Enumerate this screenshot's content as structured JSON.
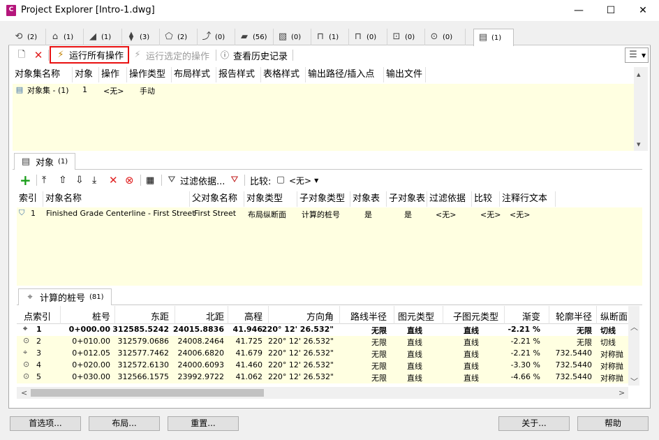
{
  "window": {
    "app_icon_text": "C",
    "title": "Project Explorer [Intro-1.dwg]",
    "minimize": "—",
    "maximize": "☐",
    "close": "✕"
  },
  "tabs": [
    {
      "icon": "alignment-icon",
      "glyph": "⟲",
      "count": "(2)"
    },
    {
      "icon": "profile-icon",
      "glyph": "⌂",
      "count": "(1)"
    },
    {
      "icon": "surface-icon",
      "glyph": "◢",
      "count": "(1)"
    },
    {
      "icon": "corridor-icon",
      "glyph": "⧫",
      "count": "(3)"
    },
    {
      "icon": "site-icon",
      "glyph": "⬠",
      "count": "(2)"
    },
    {
      "icon": "featureline-icon",
      "glyph": "⤴",
      "count": "(0)"
    },
    {
      "icon": "assembly-icon",
      "glyph": "▰",
      "count": "(56)"
    },
    {
      "icon": "parcel-icon",
      "glyph": "▧",
      "count": "(0)"
    },
    {
      "icon": "structure-icon",
      "glyph": "⊓",
      "count": "(1)"
    },
    {
      "icon": "pipe-icon",
      "glyph": "⊓",
      "count": "(0)"
    },
    {
      "icon": "section-icon",
      "glyph": "⊡",
      "count": "(0)"
    },
    {
      "icon": "view-icon",
      "glyph": "⊙",
      "count": "(0)"
    },
    {
      "icon": "objectset-icon",
      "glyph": "▤",
      "count": "(1)"
    }
  ],
  "toolbar1": {
    "new_label": "",
    "delete_label": "",
    "run_all": "运行所有操作",
    "run_selected": "运行选定的操作",
    "view_history": "查看历史记录"
  },
  "objectsets": {
    "columns": [
      "对象集名称",
      "对象",
      "操作",
      "操作类型",
      "布局样式",
      "报告样式",
      "表格样式",
      "输出路径/插入点",
      "输出文件"
    ],
    "row": {
      "name": "对象集 - (1)",
      "objects": "1",
      "operation": "<无>",
      "op_type": "手动"
    }
  },
  "objects_section": {
    "tab_label": "对象",
    "tab_count": "(1)",
    "filter_label": "过滤依据...",
    "compare_label": "比较:",
    "compare_value": "<无>",
    "columns": [
      "索引",
      "对象名称",
      "父对象名称",
      "对象类型",
      "子对象类型",
      "对象表",
      "子对象表",
      "过滤依据",
      "比较",
      "注释行文本"
    ],
    "row": {
      "index": "1",
      "name": "Finished Grade Centerline - First Street",
      "parent": "First Street",
      "type": "布局纵断面",
      "subtype": "计算的桩号",
      "obj_table": "是",
      "sub_table": "是",
      "filter": "<无>",
      "compare": "<无>",
      "annot": "<无>"
    }
  },
  "stations_section": {
    "tab_label": "计算的桩号",
    "tab_count": "(81)",
    "columns": [
      "点索引",
      "桩号",
      "东距",
      "北距",
      "高程",
      "方向角",
      "路线半径",
      "图元类型",
      "子图元类型",
      "渐变",
      "轮廓半径",
      "纵断面"
    ],
    "rows": [
      {
        "idx": "1",
        "sta": "0+000.00",
        "east": "312585.5242",
        "north": "24015.8836",
        "elev": "41.946",
        "dir": "220° 12' 26.532\"",
        "rad": "无限",
        "type": "直线",
        "sub": "直线",
        "grade": "-2.21 %",
        "prad": "无限",
        "prof": "切线",
        "bold": true
      },
      {
        "idx": "2",
        "sta": "0+010.00",
        "east": "312579.0686",
        "north": "24008.2464",
        "elev": "41.725",
        "dir": "220° 12' 26.532\"",
        "rad": "无限",
        "type": "直线",
        "sub": "直线",
        "grade": "-2.21 %",
        "prad": "无限",
        "prof": "切线"
      },
      {
        "idx": "3",
        "sta": "0+012.05",
        "east": "312577.7462",
        "north": "24006.6820",
        "elev": "41.679",
        "dir": "220° 12' 26.532\"",
        "rad": "无限",
        "type": "直线",
        "sub": "直线",
        "grade": "-2.21 %",
        "prad": "732.5440",
        "prof": "对称抛"
      },
      {
        "idx": "4",
        "sta": "0+020.00",
        "east": "312572.6130",
        "north": "24000.6093",
        "elev": "41.460",
        "dir": "220° 12' 26.532\"",
        "rad": "无限",
        "type": "直线",
        "sub": "直线",
        "grade": "-3.30 %",
        "prad": "732.5440",
        "prof": "对称抛"
      },
      {
        "idx": "5",
        "sta": "0+030.00",
        "east": "312566.1575",
        "north": "23992.9722",
        "elev": "41.062",
        "dir": "220° 12' 26.532\"",
        "rad": "无限",
        "type": "直线",
        "sub": "直线",
        "grade": "-4.66 %",
        "prad": "732.5440",
        "prof": "对称抛"
      }
    ]
  },
  "buttons": {
    "preferences": "首选项...",
    "layout": "布局...",
    "reset": "重置...",
    "about": "关于...",
    "help": "帮助"
  },
  "colors": {
    "highlight_yellow": "#ffffe1",
    "run_all_border": "#e81010",
    "add_green": "#1a9e1a",
    "delete_red": "#e02020"
  }
}
